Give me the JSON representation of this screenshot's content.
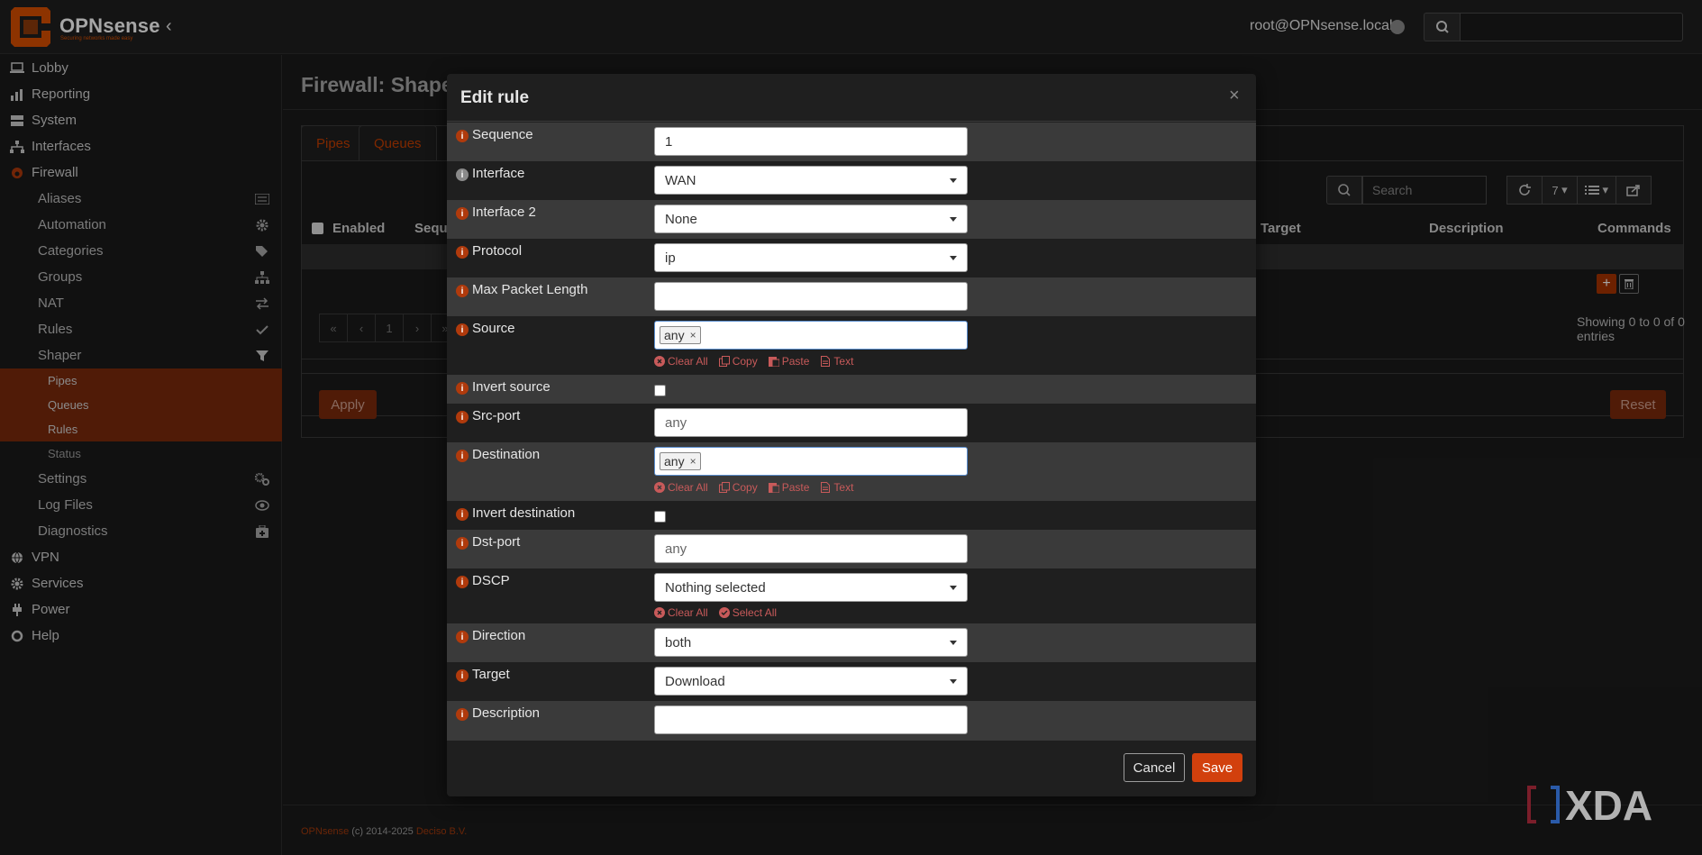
{
  "brand": {
    "name": "OPNsense",
    "tagline": "Securing networks made easy",
    "color": "#d94f00"
  },
  "topbar": {
    "user": "root@OPNsense.local",
    "search_placeholder": ""
  },
  "sidebar": {
    "items": [
      {
        "label": "Lobby",
        "icon": "laptop-icon"
      },
      {
        "label": "Reporting",
        "icon": "chart-icon"
      },
      {
        "label": "System",
        "icon": "server-icon"
      },
      {
        "label": "Interfaces",
        "icon": "network-icon"
      },
      {
        "label": "Firewall",
        "icon": "fire-icon"
      }
    ],
    "firewall_sub": [
      {
        "label": "Aliases",
        "icon": "list-icon"
      },
      {
        "label": "Automation",
        "icon": "gear-icon"
      },
      {
        "label": "Categories",
        "icon": "tags-icon"
      },
      {
        "label": "Groups",
        "icon": "sitemap-icon"
      },
      {
        "label": "NAT",
        "icon": "exchange-icon"
      },
      {
        "label": "Rules",
        "icon": "check-icon"
      },
      {
        "label": "Shaper",
        "icon": "filter-icon"
      }
    ],
    "shaper_sub": [
      "Pipes",
      "Queues",
      "Rules",
      "Status"
    ],
    "firewall_sub2": [
      {
        "label": "Settings",
        "icon": "gears-icon"
      },
      {
        "label": "Log Files",
        "icon": "eye-icon"
      },
      {
        "label": "Diagnostics",
        "icon": "medkit-icon"
      }
    ],
    "items2": [
      {
        "label": "VPN",
        "icon": "globe-icon"
      },
      {
        "label": "Services",
        "icon": "cog-icon"
      },
      {
        "label": "Power",
        "icon": "plug-icon"
      },
      {
        "label": "Help",
        "icon": "lifering-icon"
      }
    ]
  },
  "page": {
    "title": "Firewall: Shaper",
    "tabs": [
      "Pipes",
      "Queues"
    ],
    "search_placeholder": "Search",
    "row_count": "7",
    "columns": {
      "enabled": "Enabled",
      "sequence": "Seque",
      "target": "Target",
      "description": "Description",
      "commands": "Commands"
    },
    "pager": [
      "«",
      "‹",
      "1",
      "›",
      "»"
    ],
    "showing": "Showing 0 to 0 of 0 entries",
    "apply": "Apply",
    "reset": "Reset"
  },
  "footer": {
    "brand": "OPNsense",
    "copy": " (c) 2014-2025 ",
    "company": "Deciso B.V."
  },
  "modal": {
    "title": "Edit rule",
    "close": "×",
    "fields": {
      "sequence": {
        "label": "Sequence",
        "value": "1"
      },
      "interface": {
        "label": "Interface",
        "value": "WAN"
      },
      "interface2": {
        "label": "Interface 2",
        "value": "None"
      },
      "protocol": {
        "label": "Protocol",
        "value": "ip"
      },
      "max_packet_length": {
        "label": "Max Packet Length",
        "value": ""
      },
      "source": {
        "label": "Source",
        "tag": "any"
      },
      "invert_source": {
        "label": "Invert source"
      },
      "src_port": {
        "label": "Src-port",
        "value": "any"
      },
      "destination": {
        "label": "Destination",
        "tag": "any"
      },
      "invert_destination": {
        "label": "Invert destination"
      },
      "dst_port": {
        "label": "Dst-port",
        "value": "any"
      },
      "dscp": {
        "label": "DSCP",
        "value": "Nothing selected"
      },
      "direction": {
        "label": "Direction",
        "value": "both"
      },
      "target": {
        "label": "Target",
        "value": "Download"
      },
      "description": {
        "label": "Description",
        "value": ""
      }
    },
    "tools": {
      "clear_all": "Clear All",
      "copy": "Copy",
      "paste": "Paste",
      "text": "Text",
      "select_all": "Select All"
    },
    "tag_remove": "×",
    "cancel": "Cancel",
    "save": "Save"
  },
  "watermark": "XDA"
}
